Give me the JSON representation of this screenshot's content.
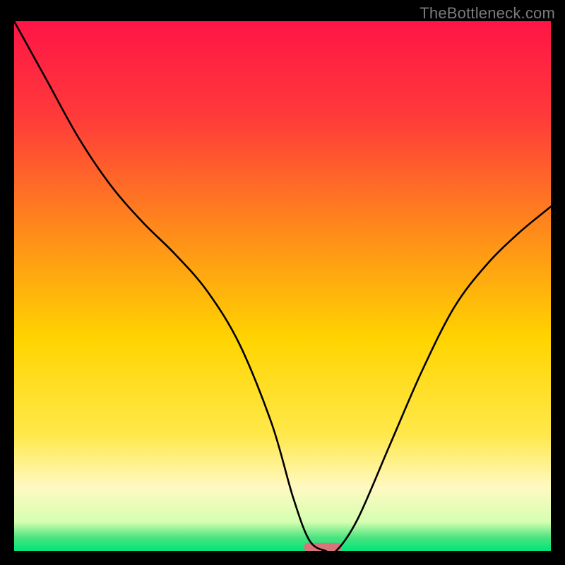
{
  "watermark": "TheBottleneck.com",
  "chart_data": {
    "type": "line",
    "title": "",
    "xlabel": "",
    "ylabel": "",
    "xlim": [
      0,
      100
    ],
    "ylim": [
      0,
      100
    ],
    "grid": false,
    "legend": false,
    "background_gradient_stops": [
      {
        "offset": 0.0,
        "color": "#ff1546"
      },
      {
        "offset": 0.18,
        "color": "#ff3a3a"
      },
      {
        "offset": 0.4,
        "color": "#ff8c1a"
      },
      {
        "offset": 0.6,
        "color": "#ffd400"
      },
      {
        "offset": 0.78,
        "color": "#ffe84a"
      },
      {
        "offset": 0.88,
        "color": "#fff9c2"
      },
      {
        "offset": 0.945,
        "color": "#d6ffb0"
      },
      {
        "offset": 0.975,
        "color": "#4be37f"
      },
      {
        "offset": 1.0,
        "color": "#00e57a"
      }
    ],
    "series": [
      {
        "name": "bottleneck-curve",
        "x": [
          0,
          6,
          12,
          18,
          24,
          30,
          36,
          42,
          48,
          52,
          55,
          58,
          60,
          64,
          70,
          76,
          82,
          88,
          94,
          100
        ],
        "y": [
          100,
          89,
          78,
          69,
          62,
          56,
          49,
          39,
          24,
          10,
          2,
          0,
          0,
          6,
          20,
          34,
          46,
          54,
          60,
          65
        ]
      }
    ],
    "minimum_marker": {
      "x_start": 54,
      "x_end": 61,
      "y": 0.7,
      "color": "#d9747a"
    }
  }
}
